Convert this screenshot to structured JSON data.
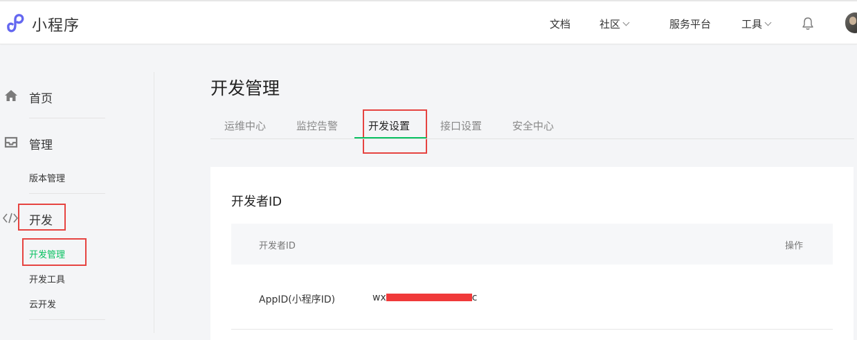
{
  "header": {
    "logo_text": "小程序",
    "nav": [
      {
        "label": "文档",
        "dropdown": false
      },
      {
        "label": "社区",
        "dropdown": true
      },
      {
        "label": "服务平台",
        "dropdown": false
      },
      {
        "label": "工具",
        "dropdown": true
      }
    ],
    "bell_icon": "bell-icon",
    "accent_color": "#6467f0"
  },
  "sidebar": {
    "home": {
      "label": "首页",
      "icon": "home-icon"
    },
    "manage": {
      "label": "管理",
      "icon": "inbox-icon",
      "items": [
        {
          "label": "版本管理"
        }
      ]
    },
    "develop": {
      "label": "开发",
      "icon": "code-icon",
      "items": [
        {
          "label": "开发管理",
          "active": true
        },
        {
          "label": "开发工具"
        },
        {
          "label": "云开发"
        }
      ]
    },
    "active_color": "#07c160"
  },
  "main": {
    "title": "开发管理",
    "tabs": [
      {
        "label": "运维中心"
      },
      {
        "label": "监控告警"
      },
      {
        "label": "开发设置",
        "active": true
      },
      {
        "label": "接口设置"
      },
      {
        "label": "安全中心"
      }
    ],
    "card": {
      "title": "开发者ID",
      "columns": [
        "开发者ID",
        "操作"
      ],
      "rows": [
        {
          "label": "AppID(小程序ID)",
          "value_prefix": "wx",
          "value_suffix": "c",
          "value_redacted": true
        }
      ]
    }
  },
  "annotations": {
    "highlight_color": "#e64340"
  }
}
